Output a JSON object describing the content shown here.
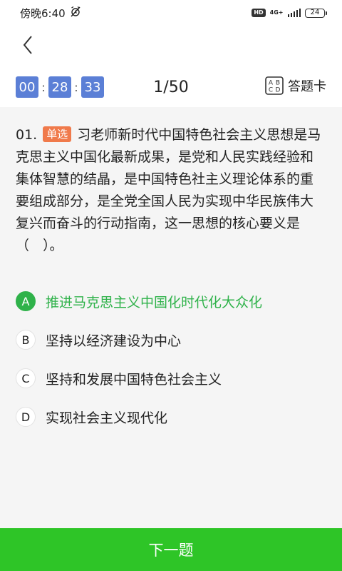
{
  "status_bar": {
    "time": "傍晚6:40",
    "hd": "HD",
    "network": "4G+",
    "battery": "24"
  },
  "timer": {
    "hours": "00",
    "minutes": "28",
    "seconds": "33",
    "separator": ":"
  },
  "progress": "1/50",
  "answer_card": {
    "icon_letters": [
      "A",
      "B",
      "C",
      "D"
    ],
    "label": "答题卡"
  },
  "question": {
    "number": "01.",
    "type": "单选",
    "text": "习老师新时代中国特色社会主义思想是马克思主义中国化最新成果，是党和人民实践经验和集体智慧的结晶，是中国特色社主义理论体系的重要组成部分，是全党全国人民为实现中华民族伟大复兴而奋斗的行动指南，这一思想的核心要义是（　）。"
  },
  "options": [
    {
      "letter": "A",
      "text": "推进马克思主义中国化时代化大众化",
      "selected": true
    },
    {
      "letter": "B",
      "text": "坚持以经济建设为中心",
      "selected": false
    },
    {
      "letter": "C",
      "text": "坚持和发展中国特色社会主义",
      "selected": false
    },
    {
      "letter": "D",
      "text": "实现社会主义现代化",
      "selected": false
    }
  ],
  "next_button": "下一题",
  "colors": {
    "timer_box": "#5b7fd6",
    "type_tag": "#f07a4b",
    "selected_option": "#2fb24a",
    "next_button": "#2ec527",
    "question_bg": "#f5f5f5"
  }
}
